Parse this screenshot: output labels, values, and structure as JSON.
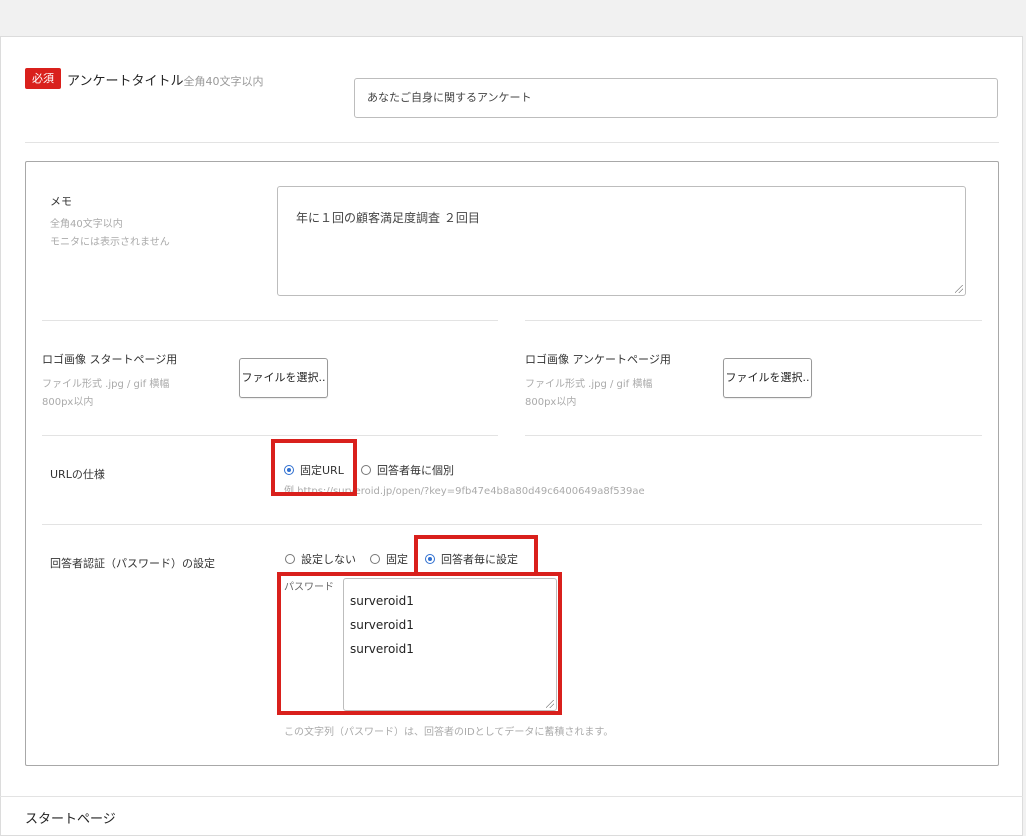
{
  "survey_title": {
    "badge": "必須",
    "label": "アンケートタイトル",
    "hint": "全角40文字以内",
    "value": "あなたご自身に関するアンケート"
  },
  "memo": {
    "label": "メモ",
    "hint1": "全角40文字以内",
    "hint2": "モニタには表示されません",
    "value": "年に１回の顧客満足度調査 ２回目"
  },
  "logo_start": {
    "label": "ロゴ画像 スタートページ用",
    "hint1": "ファイル形式 .jpg / gif 横幅",
    "hint2": "800px以内",
    "button": "ファイルを選択.."
  },
  "logo_survey": {
    "label": "ロゴ画像 アンケートページ用",
    "hint1": "ファイル形式 .jpg / gif 横幅",
    "hint2": "800px以内",
    "button": "ファイルを選択.."
  },
  "url_spec": {
    "label": "URLの仕様",
    "options": [
      "固定URL",
      "回答者毎に個別"
    ],
    "selected": "固定URL",
    "example_prefix": "例",
    "example_url": "https://surveroid.jp/open/?key=9fb47e4b8a80d49c6400649a8f539ae"
  },
  "password_auth": {
    "label": "回答者認証（パスワード）の設定",
    "options": [
      "設定しない",
      "固定",
      "回答者毎に設定"
    ],
    "selected": "回答者毎に設定",
    "field_label": "パスワード",
    "value": "surveroid1\nsurveroid1\nsurveroid1",
    "note": "この文字列（パスワード）は、回答者のIDとしてデータに蓄積されます。"
  },
  "start_page": {
    "label": "スタートページ"
  },
  "colors": {
    "required_badge": "#d9201c",
    "highlight_box": "#d9201c",
    "radio_selected": "#2f6fd0"
  }
}
